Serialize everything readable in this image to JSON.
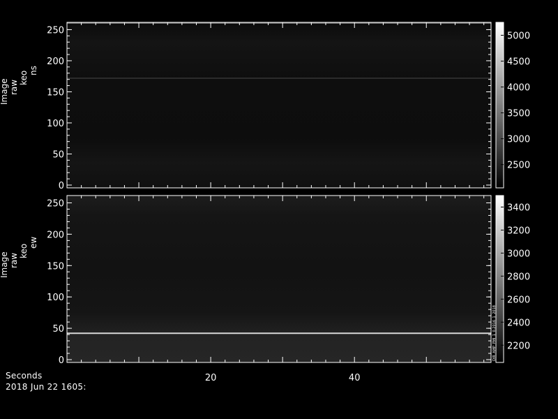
{
  "chart_data": [
    {
      "type": "heatmap",
      "panel": "top",
      "ylabel_lines": [
        "Image",
        "raw",
        "keo",
        "ns"
      ],
      "ylim": [
        0,
        255
      ],
      "yticks": [
        0,
        50,
        100,
        150,
        200,
        250
      ],
      "xlim": [
        0,
        59
      ],
      "xticks": [
        20,
        40
      ],
      "colorbar": {
        "range": [
          2050,
          5250
        ],
        "ticks": [
          2500,
          3000,
          3500,
          4000,
          4500,
          5000
        ]
      }
    },
    {
      "type": "heatmap",
      "panel": "bottom",
      "ylabel_lines": [
        "Image",
        "raw",
        "keo",
        "ew"
      ],
      "ylim": [
        0,
        255
      ],
      "yticks": [
        0,
        50,
        100,
        150,
        200,
        250
      ],
      "xlim": [
        0,
        59
      ],
      "xticks": [
        20,
        40
      ],
      "bright_row": 42,
      "colorbar": {
        "range": [
          2050,
          3500
        ],
        "ticks": [
          2200,
          2400,
          2600,
          2800,
          3000,
          3200,
          3400
        ]
      },
      "side_note": "DIR_AMP_PMI_1_0.2016_1_2018"
    }
  ],
  "footer": {
    "xlabel": "Seconds",
    "date": "2018 Jun 22 1605:"
  }
}
